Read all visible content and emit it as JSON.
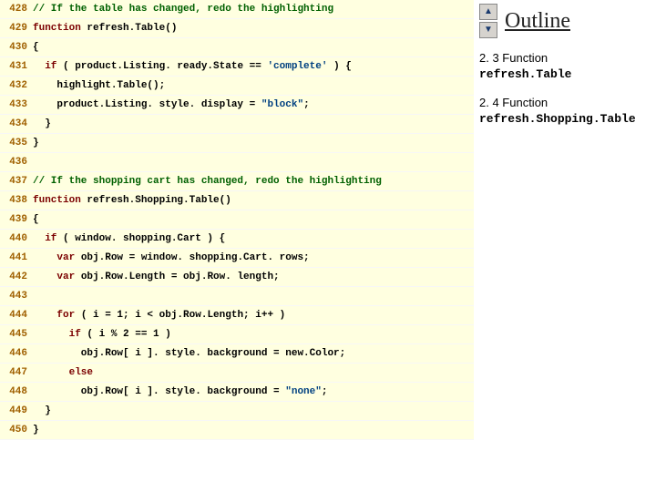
{
  "code": {
    "lines": [
      {
        "n": "428",
        "spans": [
          {
            "cls": "c-comment",
            "t": "// If the table has changed, redo the highlighting"
          }
        ]
      },
      {
        "n": "429",
        "spans": [
          {
            "cls": "c-kw",
            "t": "function"
          },
          {
            "cls": "c-plain",
            "t": " refresh.Table()"
          }
        ]
      },
      {
        "n": "430",
        "spans": [
          {
            "cls": "c-plain",
            "t": "{"
          }
        ]
      },
      {
        "n": "431",
        "spans": [
          {
            "cls": "c-plain",
            "t": "  "
          },
          {
            "cls": "c-kw",
            "t": "if"
          },
          {
            "cls": "c-plain",
            "t": " ( product.Listing. ready.State == "
          },
          {
            "cls": "c-str",
            "t": "'complete'"
          },
          {
            "cls": "c-plain",
            "t": " ) {"
          }
        ]
      },
      {
        "n": "432",
        "spans": [
          {
            "cls": "c-plain",
            "t": "    highlight.Table();"
          }
        ]
      },
      {
        "n": "433",
        "spans": [
          {
            "cls": "c-plain",
            "t": "    product.Listing. style. display = "
          },
          {
            "cls": "c-str",
            "t": "\"block\""
          },
          {
            "cls": "c-plain",
            "t": ";"
          }
        ]
      },
      {
        "n": "434",
        "spans": [
          {
            "cls": "c-plain",
            "t": "  }"
          }
        ]
      },
      {
        "n": "435",
        "spans": [
          {
            "cls": "c-plain",
            "t": "}"
          }
        ]
      },
      {
        "n": "436",
        "spans": [
          {
            "cls": "c-plain",
            "t": " "
          }
        ]
      },
      {
        "n": "437",
        "spans": [
          {
            "cls": "c-comment",
            "t": "// If the shopping cart has changed, redo the highlighting"
          }
        ]
      },
      {
        "n": "438",
        "spans": [
          {
            "cls": "c-kw",
            "t": "function"
          },
          {
            "cls": "c-plain",
            "t": " refresh.Shopping.Table()"
          }
        ]
      },
      {
        "n": "439",
        "spans": [
          {
            "cls": "c-plain",
            "t": "{"
          }
        ]
      },
      {
        "n": "440",
        "spans": [
          {
            "cls": "c-plain",
            "t": "  "
          },
          {
            "cls": "c-kw",
            "t": "if"
          },
          {
            "cls": "c-plain",
            "t": " ( window. shopping.Cart ) {"
          }
        ]
      },
      {
        "n": "441",
        "spans": [
          {
            "cls": "c-plain",
            "t": "    "
          },
          {
            "cls": "c-kw",
            "t": "var"
          },
          {
            "cls": "c-plain",
            "t": " obj.Row = window. shopping.Cart. rows;"
          }
        ]
      },
      {
        "n": "442",
        "spans": [
          {
            "cls": "c-plain",
            "t": "    "
          },
          {
            "cls": "c-kw",
            "t": "var"
          },
          {
            "cls": "c-plain",
            "t": " obj.Row.Length = obj.Row. length;"
          }
        ]
      },
      {
        "n": "443",
        "spans": [
          {
            "cls": "c-plain",
            "t": " "
          }
        ]
      },
      {
        "n": "444",
        "spans": [
          {
            "cls": "c-plain",
            "t": "    "
          },
          {
            "cls": "c-kw",
            "t": "for"
          },
          {
            "cls": "c-plain",
            "t": " ( i = 1; i < obj.Row.Length; i++ )"
          }
        ]
      },
      {
        "n": "445",
        "spans": [
          {
            "cls": "c-plain",
            "t": "      "
          },
          {
            "cls": "c-kw",
            "t": "if"
          },
          {
            "cls": "c-plain",
            "t": " ( i % 2 == 1 )"
          }
        ]
      },
      {
        "n": "446",
        "spans": [
          {
            "cls": "c-plain",
            "t": "        obj.Row[ i ]. style. background = new.Color;"
          }
        ]
      },
      {
        "n": "447",
        "spans": [
          {
            "cls": "c-plain",
            "t": "      "
          },
          {
            "cls": "c-kw",
            "t": "else"
          }
        ]
      },
      {
        "n": "448",
        "spans": [
          {
            "cls": "c-plain",
            "t": "        obj.Row[ i ]. style. background = "
          },
          {
            "cls": "c-str",
            "t": "\"none\""
          },
          {
            "cls": "c-plain",
            "t": ";"
          }
        ]
      },
      {
        "n": "449",
        "spans": [
          {
            "cls": "c-plain",
            "t": "  }"
          }
        ]
      },
      {
        "n": "450",
        "spans": [
          {
            "cls": "c-plain",
            "t": "}"
          }
        ]
      }
    ]
  },
  "outline": {
    "title": "Outline",
    "arrow_up": "▲",
    "arrow_down": "▼",
    "items": [
      {
        "num": "2. 3 Function",
        "fn": "refresh.Table"
      },
      {
        "num": "2. 4 Function",
        "fn": "refresh.Shopping.Table"
      }
    ]
  }
}
